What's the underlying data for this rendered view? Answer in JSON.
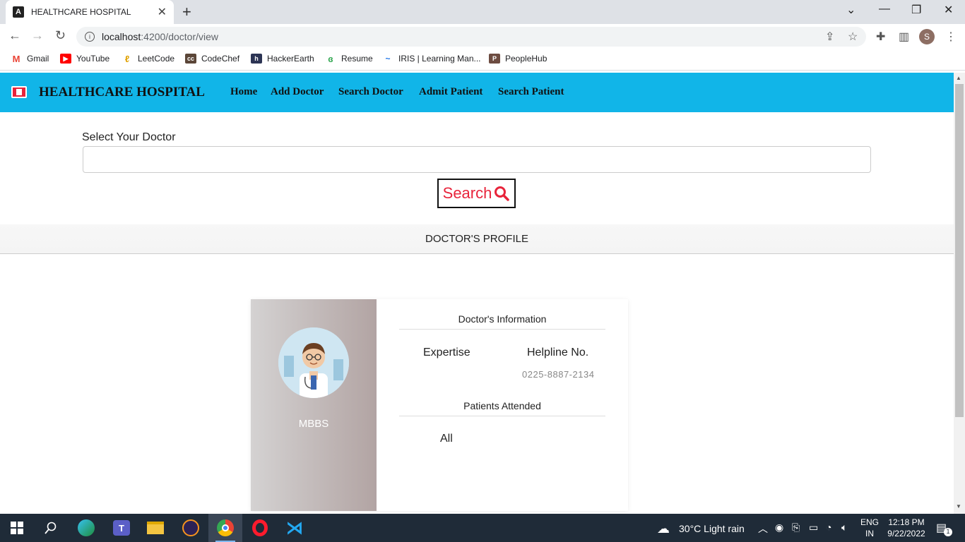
{
  "browser": {
    "tab_title": "HEALTHCARE HOSPITAL",
    "url_host": "localhost",
    "url_path": ":4200/doctor/view",
    "profile_initial": "S",
    "bookmarks": [
      "Gmail",
      "YouTube",
      "LeetCode",
      "CodeChef",
      "HackerEarth",
      "Resume",
      "IRIS | Learning Man...",
      "PeopleHub"
    ]
  },
  "app": {
    "brand": "HEALTHCARE HOSPITAL",
    "nav": [
      "Home",
      "Add Doctor",
      "Search Doctor",
      "Admit Patient",
      "Search Patient"
    ],
    "select_label": "Select Your Doctor",
    "select_value": "",
    "search_label": "Search",
    "profile_heading": "DOCTOR'S PROFILE",
    "card": {
      "degree": "MBBS",
      "info_title": "Doctor's Information",
      "expertise_label": "Expertise",
      "helpline_label": "Helpline No.",
      "helpline_value": "0225-8887-2134",
      "patients_title": "Patients Attended",
      "patients_value": "All"
    }
  },
  "taskbar": {
    "weather": "30°C  Light rain",
    "lang_top": "ENG",
    "lang_bottom": "IN",
    "time": "12:18 PM",
    "date": "9/22/2022",
    "notification_count": "1"
  },
  "colors": {
    "navbar": "#11b5e8",
    "search_text": "#e8243b",
    "taskbar": "#1f2b38"
  }
}
